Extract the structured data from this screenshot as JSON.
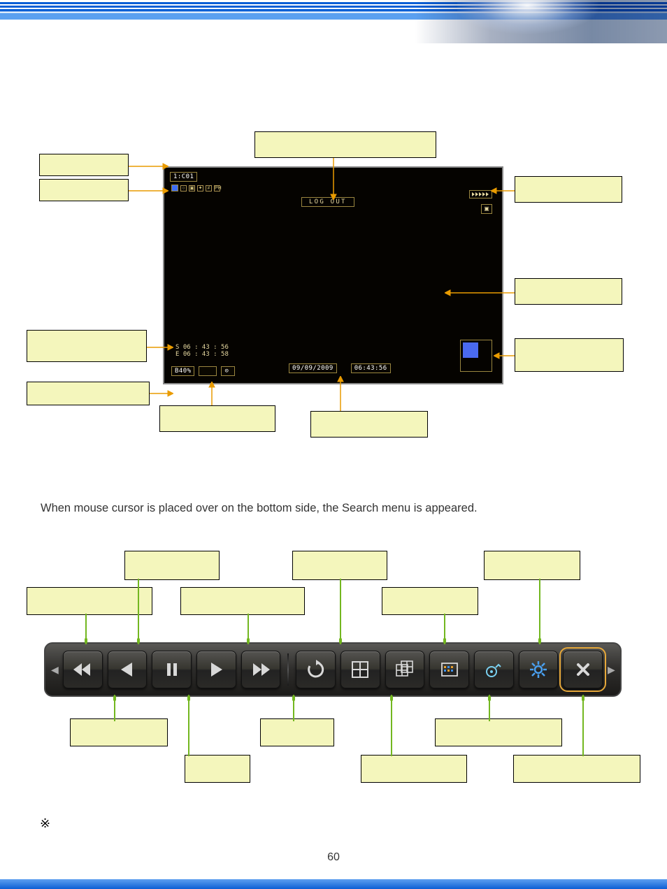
{
  "dvr": {
    "channel": "1:C01",
    "logout": "LOG OUT",
    "start": "S 06 : 43 : 56",
    "end": "E 06 : 43 : 58",
    "backup": "B40%",
    "date": "09/09/2009",
    "time": "06:43:56"
  },
  "body_text": "When mouse cursor is placed over on the bottom side, the Search menu is appeared.",
  "note_symbol": "※",
  "page_number": "60",
  "callouts": {
    "top1": "",
    "left1": "",
    "left2": "",
    "right1": "",
    "right2": "",
    "left3": "",
    "right3": "",
    "left4": "",
    "bottom_left": "",
    "bottom_right": "",
    "tb_top_left": "",
    "tb_top_1": "",
    "tb_top_2": "",
    "tb_top_mid": "",
    "tb_top_3": "",
    "tb_top_right": "",
    "tb_bot_1": "",
    "tb_bot_2": "",
    "tb_bot_3": "",
    "tb_bot_4": "",
    "tb_bot_5": "",
    "tb_bot_6": ""
  }
}
